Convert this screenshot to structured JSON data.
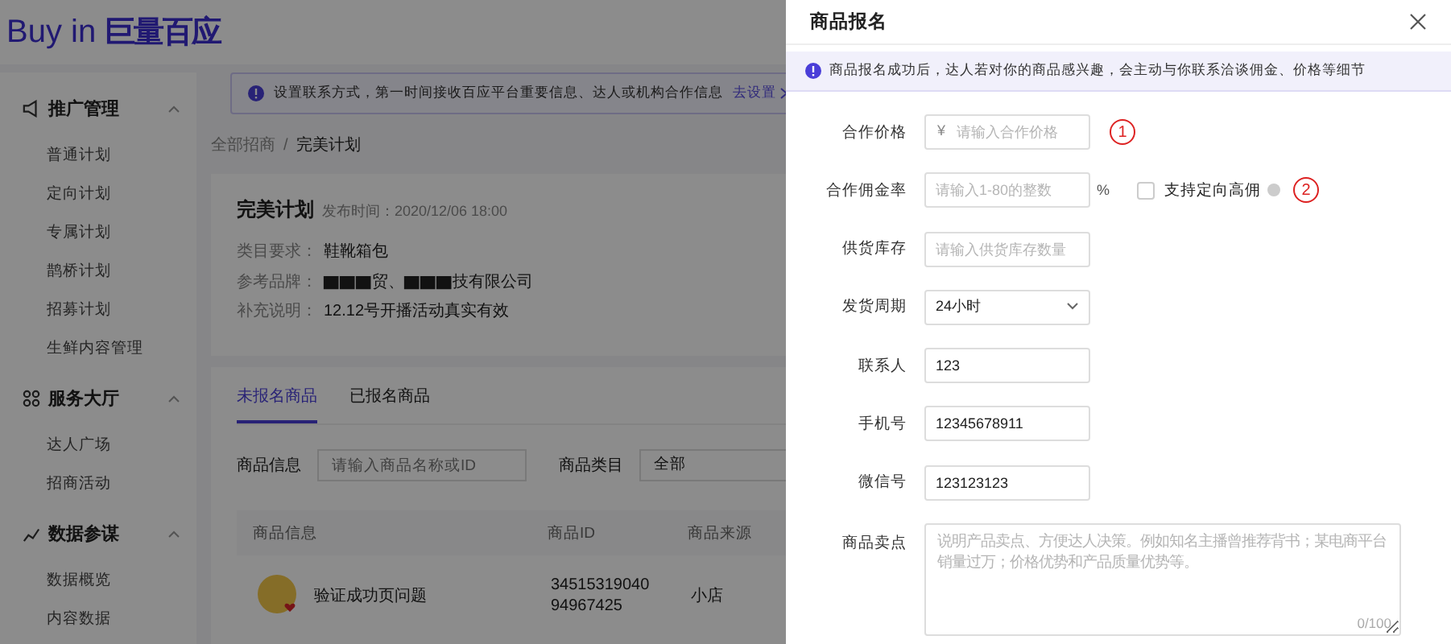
{
  "header": {
    "logo_latin": "Buy in",
    "logo_cn": "巨量百应"
  },
  "sidebar": {
    "sections": [
      {
        "title": "推广管理",
        "expanded": true,
        "items": [
          "普通计划",
          "定向计划",
          "专属计划",
          "鹊桥计划",
          "招募计划",
          "生鲜内容管理"
        ]
      },
      {
        "title": "服务大厅",
        "expanded": true,
        "items": [
          "达人广场",
          "招商活动"
        ]
      },
      {
        "title": "数据参谋",
        "expanded": true,
        "items": [
          "数据概览",
          "内容数据"
        ]
      }
    ]
  },
  "notice": {
    "text": "设置联系方式，第一时间接收百应平台重要信息、达人或机构合作信息",
    "link": "去设置"
  },
  "breadcrumb": {
    "items": [
      "全部招商",
      "完美计划"
    ],
    "separator": "/"
  },
  "plan": {
    "title": "完美计划",
    "published": "发布时间：2020/12/06 18:00",
    "fields": [
      {
        "label": "类目要求：",
        "value": "鞋靴箱包"
      },
      {
        "label": "参考品牌：",
        "value": "▇▇▇贸、▇▇▇技有限公司"
      },
      {
        "label": "补充说明：",
        "value": "12.12号开播活动真实有效"
      }
    ]
  },
  "tabs": [
    {
      "label": "未报名商品",
      "selected": true
    },
    {
      "label": "已报名商品",
      "selected": false
    }
  ],
  "filters": [
    {
      "kind": "input",
      "label": "商品信息",
      "placeholder": "请输入商品名称或ID"
    },
    {
      "kind": "select",
      "label": "商品类目",
      "value": "全部"
    }
  ],
  "table": {
    "columns": [
      "商品信息",
      "商品ID",
      "商品来源"
    ],
    "rows": [
      {
        "name": "验证成功页问题",
        "id": [
          "34515319040",
          "94967425"
        ],
        "source": "小店"
      }
    ]
  },
  "drawer": {
    "title": "商品报名",
    "info": "商品报名成功后，达人若对你的商品感兴趣，会主动与你联系洽谈佣金、价格等细节",
    "fields": [
      {
        "kind": "input",
        "label": "合作价格",
        "prefix": "¥",
        "placeholder": "请输入合作价格",
        "marker": "1"
      },
      {
        "kind": "input",
        "label": "合作佣金率",
        "placeholder": "请输入1-80的整数",
        "suffix": "%",
        "option": {
          "label": "支持定向高佣",
          "checked": false
        },
        "marker": "2"
      },
      {
        "kind": "input",
        "label": "供货库存",
        "placeholder": "请输入供货库存数量"
      },
      {
        "kind": "select",
        "label": "发货周期",
        "value": "24小时"
      },
      {
        "kind": "input",
        "label": "联系人",
        "value": "123"
      },
      {
        "kind": "input",
        "label": "手机号",
        "value": "12345678911"
      },
      {
        "kind": "input",
        "label": "微信号",
        "value": "123123123"
      },
      {
        "kind": "textarea",
        "label": "商品卖点",
        "placeholder": "说明产品卖点、方便达人决策。例如知名主播曾推荐背书；某电商平台销量过万；价格优势和产品质量优势等。",
        "counter": "0/100"
      }
    ]
  }
}
